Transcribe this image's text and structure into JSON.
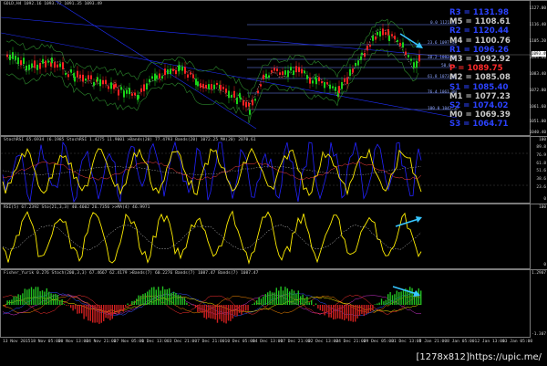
{
  "main_chart": {
    "title": "GOLD,H4  1092.16 1093.72 1091.35 1093.49",
    "current_price": "1093.49",
    "price_scale": [
      "1127.00",
      "1116.40",
      "1105.20",
      "1094.60",
      "1083.40",
      "1072.80",
      "1061.60",
      "1051.00",
      "1040.40"
    ],
    "fib_levels": [
      "0.0  1121.01",
      "23.6  1097.49",
      "38.2  1082.85",
      "50.0",
      "61.8  1073.82",
      "76.4  1061.09",
      "100.0  1047.37"
    ],
    "pivots": [
      {
        "label": "R3 = 1131.98",
        "color": "#2b42ff"
      },
      {
        "label": "M5 = 1108.61",
        "color": "#c8c8c8"
      },
      {
        "label": "R2 = 1120.44",
        "color": "#2b42ff"
      },
      {
        "label": "M4 = 1100.76",
        "color": "#c8c8c8"
      },
      {
        "label": "R1 = 1096.26",
        "color": "#2b42ff"
      },
      {
        "label": "M3 = 1092.92",
        "color": "#c8c8c8"
      },
      {
        "label": "P = 1089.75",
        "color": "#ff2a2a"
      },
      {
        "label": "M2 = 1085.08",
        "color": "#c8c8c8"
      },
      {
        "label": "S1 = 1085.40",
        "color": "#2b42ff"
      },
      {
        "label": "M1 = 1077.23",
        "color": "#c8c8c8"
      },
      {
        "label": "S2 = 1074.02",
        "color": "#2b42ff"
      },
      {
        "label": "M0 = 1069.39",
        "color": "#c8c8c8"
      },
      {
        "label": "S3 = 1064.71",
        "color": "#2b42ff"
      }
    ]
  },
  "stoch_rsi_pane": {
    "title": "StochRSI 65.6934 (6.1985  StochRSI 1.4275 11.9001  >Bands(20) 77.4793  Bands(20) 1072.25  MA(20) 2070.61",
    "scale": [
      "100",
      "89.8",
      "76.9",
      "61.8",
      "51.6",
      "38.6",
      "23.6",
      "0"
    ]
  },
  "rsi_pane": {
    "title": "RSI(5) 67.2392  Sto(21,3,3) 40.4602 26.7356  >>MA(4) 46.9971",
    "scale": [
      "100",
      "",
      "",
      "",
      "0"
    ]
  },
  "fisher_pane": {
    "title": "Fisher_Yurik 0.276  Stoch(200,3,3) 67.4667 62.4179  >Bands(7) 60.2276  Bands(7) 1087.47  Bands(7) 1087.47",
    "scale": [
      "1.2907",
      "",
      "",
      "-1.307"
    ]
  },
  "time_axis": [
    "13 Nov 2015",
    "18 Nov 05:00",
    "20 Nov 13:00",
    "24 Nov 21:00",
    "27 Nov 05:00",
    "1 Dec 13:00",
    "3 Dec 21:00",
    "7 Dec 21:00",
    "10 Dec 05:00",
    "14 Dec 13:00",
    "17 Dec 21:00",
    "22 Dec 13:00",
    "24 Dec 21:00",
    "29 Dec 05:00",
    "31 Dec 13:00",
    "5 Jan 21:00",
    "8 Jan 05:00",
    "12 Jan 13:00",
    "13 Jan 05:00"
  ],
  "watermark": "[1278x812]https://upic.me/",
  "colors": {
    "bull_candle": "#19d219",
    "bear_candle": "#ff2222",
    "stoch_line": "#ffee00",
    "stoch_blue": "#2222ff",
    "arrow": "#37c6ff",
    "fib": "#6f86ff"
  }
}
